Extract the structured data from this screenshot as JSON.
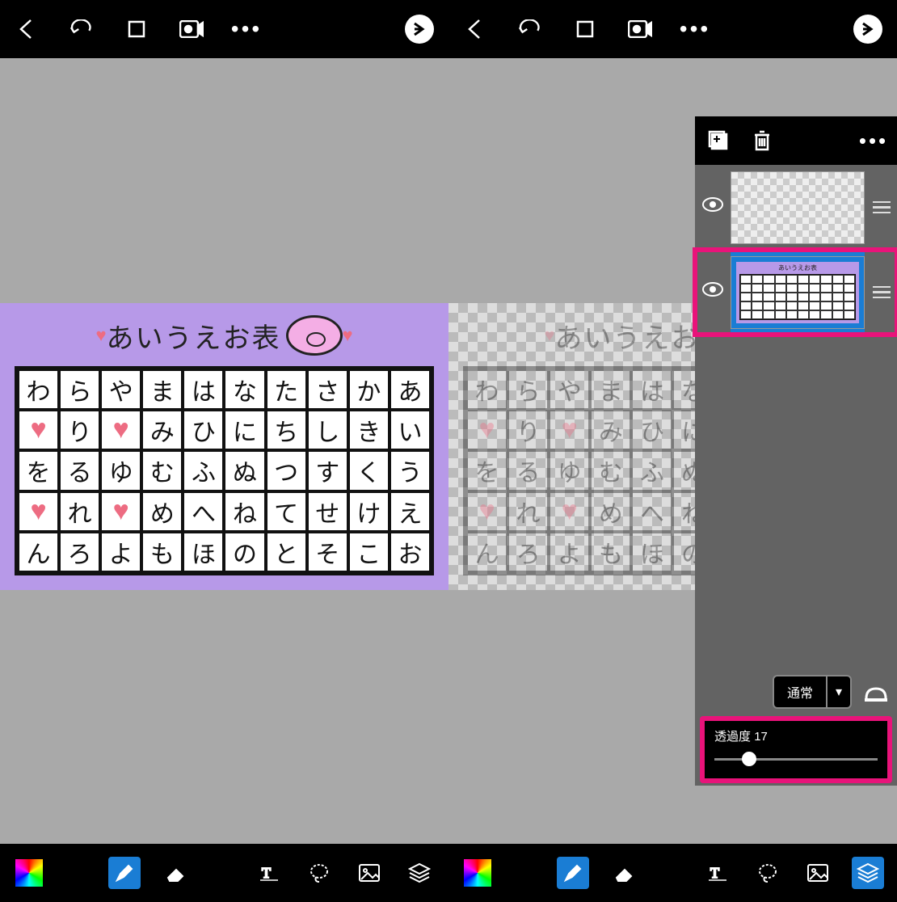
{
  "chart": {
    "title": "あいうえお表",
    "rows": [
      [
        "わ",
        "ら",
        "や",
        "ま",
        "は",
        "な",
        "た",
        "さ",
        "か",
        "あ"
      ],
      [
        "♥",
        "り",
        "♥",
        "み",
        "ひ",
        "に",
        "ち",
        "し",
        "き",
        "い"
      ],
      [
        "を",
        "る",
        "ゆ",
        "む",
        "ふ",
        "ぬ",
        "つ",
        "す",
        "く",
        "う"
      ],
      [
        "♥",
        "れ",
        "♥",
        "め",
        "へ",
        "ね",
        "て",
        "せ",
        "け",
        "え"
      ],
      [
        "ん",
        "ろ",
        "よ",
        "も",
        "ほ",
        "の",
        "と",
        "そ",
        "こ",
        "お"
      ]
    ]
  },
  "blend_mode": {
    "label": "通常"
  },
  "opacity": {
    "label": "透過度",
    "value": 17,
    "min": 0,
    "max": 100
  },
  "layers": [
    {
      "name": "empty-layer",
      "selected": false,
      "has_content": false
    },
    {
      "name": "chart-layer",
      "selected": true,
      "has_content": true
    }
  ],
  "icons": {
    "back": "‹",
    "undo": "↶",
    "crop": "□",
    "camera": "📷",
    "more": "⋯",
    "next": "→",
    "add_layer": "+",
    "trash": "🗑",
    "eye": "👁",
    "color": "",
    "brush": "",
    "eraser": "",
    "curve": "∿",
    "select": "",
    "image": "",
    "layers": ""
  }
}
